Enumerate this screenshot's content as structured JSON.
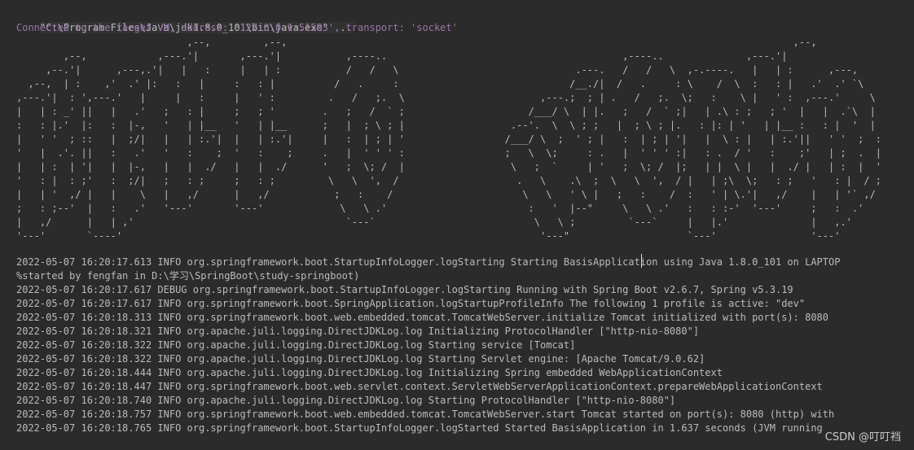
{
  "console": {
    "command_line": "\"C:\\Program Files\\Java\\jdk1.8.0_101\\bin\\java.exe\" ...",
    "connected_line": "Connected to the target VM, address: '127.0.0.1:51593', transport: 'socket'",
    "banner_ascii": "                             ,--,         ,--,                                                                                      ,--,   \n        ,--,            ,---.'|       ,---.'|           ,----..                                        ,----..              ,---.'|   \n     ,--.'|      ,---,.'|   |   :     |   | :           /   /   \\                              .---.   /   /   \\  ,-.----.   |   | :      ,---,    \n  ,--,  | :    ,'  .' |:   :   |     :   : |          /   .     :                             /__./|  /   .     : \\    /  \\  :   : |   .'  .' `\\  \n,---.'|  : ',---.'   |     |   :     |   ' :         .   /   ;.  \\                       ,---.;  ; | .   /   ;.  \\;   :    \\ |   ' :  ,---.'     \\ \n|   | : _' ||   |   .'   ;   : |     ;   ; '        .   ;   /  ` ;                     /___/ \\  | |.   ;   /  ` ;|   | .\\ : ;   ; '  |   |  .`\\  |\n:   : |.'  |:   :  |-,   '   | |__   '   | |__      ;   |  ; \\ ; |                  .--'.  \\  \\ ; ;   |  ; \\ ; |.   : |: | '   | |__ :   : |  '  |\n|   ' '  ; ::   |  ;/|   |   | :.'|  |   | :.'|     |   :  | ; | '                 /___/ \\  ;  ' ; |   :  | ; | '|   |  \\ : |   | :.'||   ' '  ;  :\n'   |  .'. ||   :   .'   '   :    ;  '   :    ;     .   |  ' ' ' :                 ;   \\  \\;     : .   |  ' ' ' :|   : .  / '   :    ;'   | ;  .  |\n|   | :  | '|   |  |-,   |   |  ./   |   |  ./      '   ;  \\; /  |                  \\   ;  `     | '   ;  \\; /  |;   | |  \\ |   |  ./ |   | :  |  '\n'   : |  : ;'   :  ;/|   ;   : ;     ;   : ;         \\   \\  ',  /                    .   \\    .\\  ;  \\   \\  ',  / |   | ;\\  \\;   : ;   '   : |  / ; \n|   | '  ,/ |   |    \\   |   ,/      |   ,/           ;   :    /                      \\   \\   ' \\ |   ;   :    /  :   ' | \\.'|   ,/    |   | '` ,/  \n;   : ;--'  |   :   .'   '---'       '---'             \\   \\ .'                        :   '  |--\"     \\   \\ .'   :   : :-'  '---'     ;   :  .'    \n|   ,/      |   | ,'                                    `---`                           \\   \\ ;         `---`     |   |.'              |   ,.'      \n'---'       `----'                                                                       '---\"                    `---'                '---'        ",
    "log_lines": [
      "2022-05-07 16:20:17.613 INFO org.springframework.boot.StartupInfoLogger.logStarting Starting BasisApplication using Java 1.8.0_101 on LAPTOP",
      "%started by fengfan in D:\\学习\\SpringBoot\\study-springboot)",
      "2022-05-07 16:20:17.617 DEBUG org.springframework.boot.StartupInfoLogger.logStarting Running with Spring Boot v2.6.7, Spring v5.3.19",
      "2022-05-07 16:20:17.617 INFO org.springframework.boot.SpringApplication.logStartupProfileInfo The following 1 profile is active: \"dev\"",
      "2022-05-07 16:20:18.313 INFO org.springframework.boot.web.embedded.tomcat.TomcatWebServer.initialize Tomcat initialized with port(s): 8080",
      "2022-05-07 16:20:18.321 INFO org.apache.juli.logging.DirectJDKLog.log Initializing ProtocolHandler [\"http-nio-8080\"]",
      "2022-05-07 16:20:18.322 INFO org.apache.juli.logging.DirectJDKLog.log Starting service [Tomcat]",
      "2022-05-07 16:20:18.322 INFO org.apache.juli.logging.DirectJDKLog.log Starting Servlet engine: [Apache Tomcat/9.0.62]",
      "2022-05-07 16:20:18.444 INFO org.apache.juli.logging.DirectJDKLog.log Initializing Spring embedded WebApplicationContext",
      "2022-05-07 16:20:18.447 INFO org.springframework.boot.web.servlet.context.ServletWebServerApplicationContext.prepareWebApplicationContext",
      "2022-05-07 16:20:18.740 INFO org.apache.juli.logging.DirectJDKLog.log Starting ProtocolHandler [\"http-nio-8080\"]",
      "2022-05-07 16:20:18.757 INFO org.springframework.boot.web.embedded.tomcat.TomcatWebServer.start Tomcat started on port(s): 8080 (http) with",
      "2022-05-07 16:20:18.765 INFO org.springframework.boot.StartupInfoLogger.logStarted Started BasisApplication in 1.637 seconds (JVM running"
    ]
  },
  "watermark": "CSDN @叮叮裆",
  "colors": {
    "background": "#2b2b2b",
    "text": "#bbbbbb",
    "connected": "#9876aa"
  }
}
